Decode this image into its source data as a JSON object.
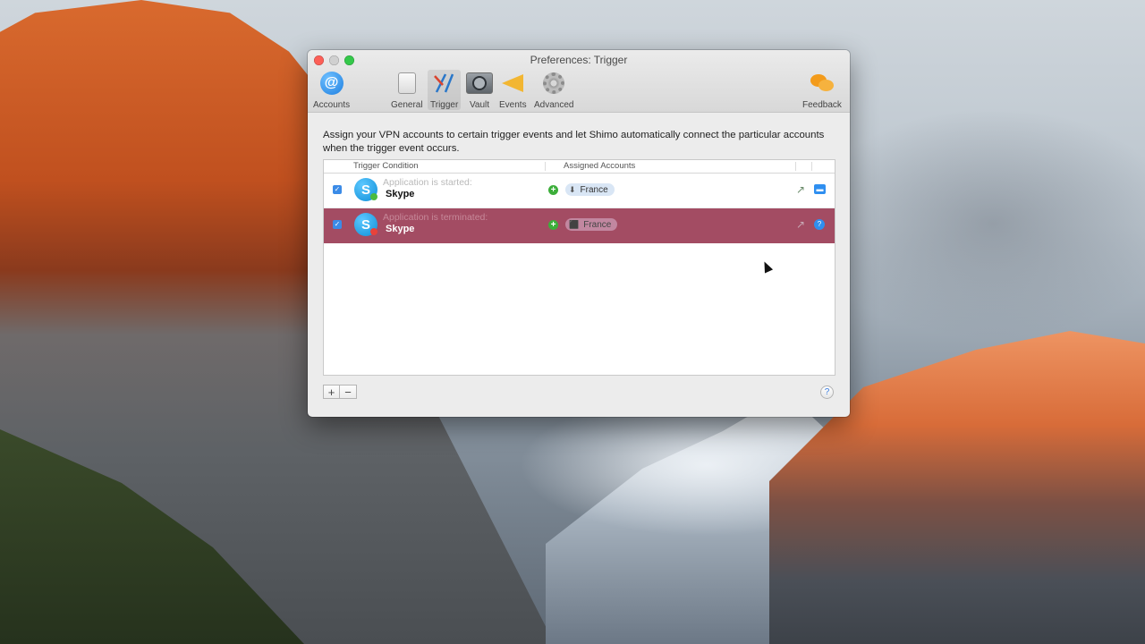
{
  "window": {
    "title": "Preferences: Trigger"
  },
  "toolbar": {
    "items": [
      {
        "label": "Accounts",
        "icon": "at-sign-icon"
      },
      {
        "label": "General",
        "icon": "switch-icon"
      },
      {
        "label": "Trigger",
        "icon": "trigger-icon",
        "selected": true
      },
      {
        "label": "Vault",
        "icon": "vault-icon"
      },
      {
        "label": "Events",
        "icon": "megaphone-icon"
      },
      {
        "label": "Advanced",
        "icon": "gear-icon"
      },
      {
        "label": "Feedback",
        "icon": "speech-bubbles-icon"
      }
    ]
  },
  "content": {
    "description": "Assign your VPN accounts to certain trigger events and let Shimo automatically connect the particular accounts when the trigger event occurs.",
    "table": {
      "columns": [
        "Trigger Condition",
        "Assigned Accounts"
      ],
      "rows": [
        {
          "checked": true,
          "condition": "Application is started:",
          "app": "Skype",
          "account": "France",
          "selected": false
        },
        {
          "checked": true,
          "condition": "Application is terminated:",
          "app": "Skype",
          "account": "France",
          "selected": true
        }
      ]
    }
  },
  "bottom": {
    "add_label": "+",
    "remove_label": "−",
    "help_label": "?"
  },
  "colors": {
    "selection": "#a34c63",
    "accent": "#3b8be7"
  }
}
